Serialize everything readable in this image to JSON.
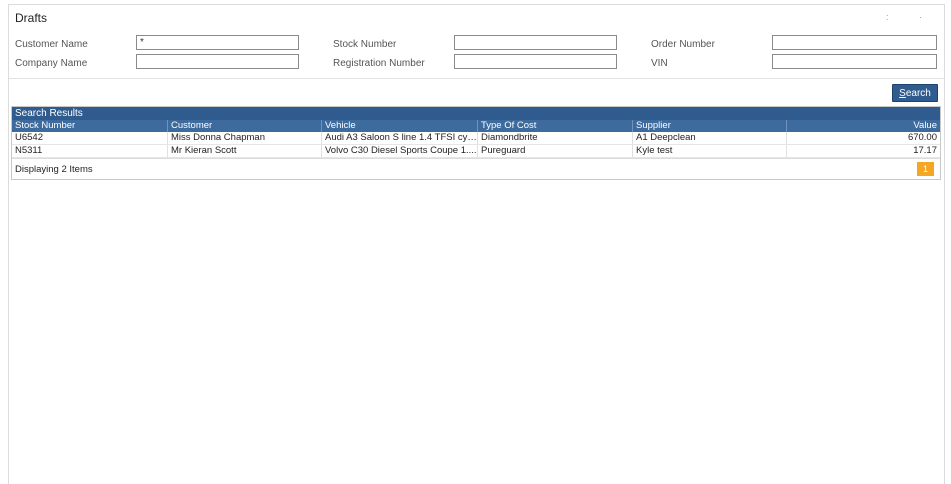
{
  "window": {
    "title": "Drafts",
    "controls": ":  ·"
  },
  "filters": {
    "customer_name": {
      "label": "Customer Name",
      "value": "*"
    },
    "company_name": {
      "label": "Company Name",
      "value": ""
    },
    "stock_number": {
      "label": "Stock Number",
      "value": ""
    },
    "registration_number": {
      "label": "Registration Number",
      "value": ""
    },
    "order_number": {
      "label": "Order Number",
      "value": ""
    },
    "vin": {
      "label": "VIN",
      "value": ""
    }
  },
  "search_button": {
    "label_underlined": "S",
    "label_rest": "earch"
  },
  "results": {
    "header": "Search Results",
    "columns": [
      "Stock Number",
      "Customer",
      "Vehicle",
      "Type Of Cost",
      "Supplier",
      "Value"
    ],
    "rows": [
      [
        "U6542",
        "Miss Donna Chapman",
        "Audi A3 Saloon S line 1.4 TFSI cyl...",
        "Diamondbrite",
        "A1 Deepclean",
        "670.00"
      ],
      [
        "N5311",
        "Mr Kieran Scott",
        "Volvo C30 Diesel Sports Coupe 1....",
        "Pureguard",
        "Kyle test",
        "17.17"
      ]
    ],
    "footer_text": "Displaying 2 Items",
    "current_page": "1"
  },
  "colors": {
    "header_blue": "#2f5b8e",
    "page_orange": "#f5a623"
  }
}
